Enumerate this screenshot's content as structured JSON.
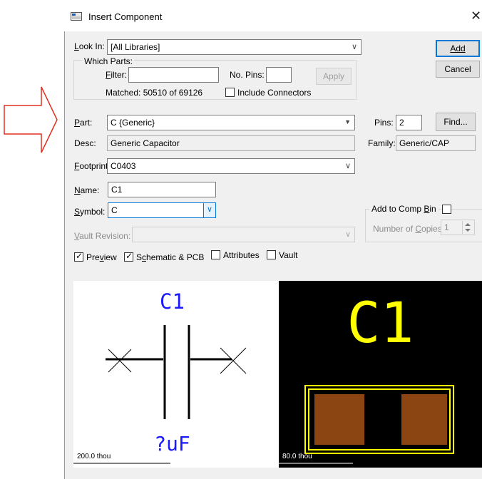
{
  "dialog": {
    "title": "Insert Component",
    "close_glyph": "✕"
  },
  "look_in": {
    "label": "Look In:",
    "value": "[All Libraries]"
  },
  "which_parts": {
    "group_label": "Which Parts:",
    "filter_label": "Filter:",
    "filter_value": "",
    "no_pins_label": "No. Pins:",
    "no_pins_value": "",
    "apply_label": "Apply",
    "matched_text": "Matched: 50510 of 69126",
    "include_connectors_label": "Include Connectors",
    "include_connectors_checked": false
  },
  "buttons": {
    "add": "Add",
    "cancel": "Cancel",
    "find": "Find..."
  },
  "part": {
    "label": "Part:",
    "value": "C {Generic}"
  },
  "pins": {
    "label": "Pins:",
    "value": "2"
  },
  "desc": {
    "label": "Desc:",
    "value": "Generic Capacitor"
  },
  "family": {
    "label": "Family:",
    "value": "Generic/CAP"
  },
  "footprint": {
    "label": "Footprint:",
    "value": "C0403"
  },
  "name": {
    "label": "Name:",
    "value": "C1"
  },
  "symbol": {
    "label": "Symbol:",
    "value": "C"
  },
  "comp_bin": {
    "group_label": "Add to Comp Bin",
    "checked": false,
    "copies_label": "Number of Copies:",
    "copies_value": "1"
  },
  "vault_revision": {
    "label": "Vault Revision:",
    "value": ""
  },
  "options": {
    "preview": {
      "label": "Preview",
      "checked": true
    },
    "schematic_pcb": {
      "label": "Schematic & PCB",
      "checked": true
    },
    "attributes": {
      "label": "Attributes",
      "checked": false
    },
    "vault": {
      "label": "Vault",
      "checked": false
    }
  },
  "schematic_preview": {
    "designator": "C1",
    "value_text": "?uF",
    "scale": "200.0 thou"
  },
  "pcb_preview": {
    "designator": "C1",
    "scale": "80.0 thou"
  },
  "colors": {
    "annotation_arrow": "#e03020",
    "schematic_text": "#1a1aff",
    "pcb_text": "#ffff00",
    "pcb_pad": "#8b4513",
    "pcb_outline": "#ffff00",
    "default_button_border": "#0078d7"
  },
  "icons": {
    "window": "window-icon",
    "dropdown": "chevron-down-icon",
    "spin": "spin-arrows-icon",
    "arrow": "red-arrow-icon"
  }
}
